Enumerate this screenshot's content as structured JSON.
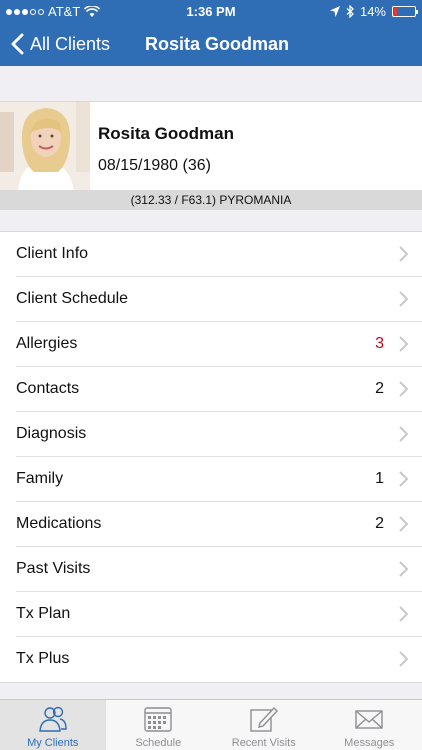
{
  "status_bar": {
    "carrier": "AT&T",
    "time": "1:36 PM",
    "battery_percent": "14%",
    "battery_level": 0.14,
    "icons": [
      "signal-dots",
      "wifi-icon",
      "location-icon",
      "bluetooth-icon",
      "battery-icon"
    ]
  },
  "nav": {
    "back_label": "All Clients",
    "title": "Rosita Goodman"
  },
  "profile": {
    "name": "Rosita Goodman",
    "dob": "08/15/1980 (36)",
    "diagnosis": "(312.33 / F63.1) PYROMANIA"
  },
  "menu": {
    "items": [
      {
        "label": "Client Info",
        "count": ""
      },
      {
        "label": "Client Schedule",
        "count": ""
      },
      {
        "label": "Allergies",
        "count": "3"
      },
      {
        "label": "Contacts",
        "count": "2"
      },
      {
        "label": "Diagnosis",
        "count": ""
      },
      {
        "label": "Family",
        "count": "1"
      },
      {
        "label": "Medications",
        "count": "2"
      },
      {
        "label": "Past Visits",
        "count": ""
      },
      {
        "label": "Tx Plan",
        "count": ""
      },
      {
        "label": "Tx Plus",
        "count": ""
      }
    ],
    "alert_color": "#d0021b"
  },
  "tabs": [
    {
      "label": "My Clients",
      "icon": "people-icon",
      "active": true
    },
    {
      "label": "Schedule",
      "icon": "calendar-icon",
      "active": false
    },
    {
      "label": "Recent Visits",
      "icon": "edit-icon",
      "active": false
    },
    {
      "label": "Messages",
      "icon": "envelope-icon",
      "active": false
    }
  ],
  "colors": {
    "brand": "#2f6db5",
    "background": "#efeff4"
  }
}
